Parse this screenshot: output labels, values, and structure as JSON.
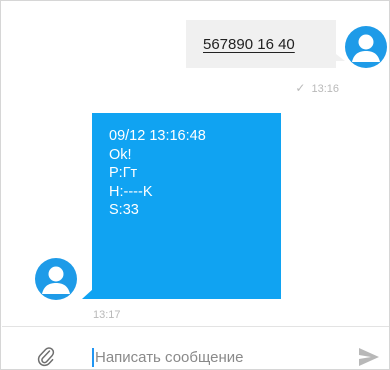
{
  "chat": {
    "outgoing": {
      "text": "567890 16 40",
      "status_icon": "check-icon",
      "status_glyph": "✓",
      "time": "13:16"
    },
    "incoming": {
      "lines": [
        "09/12 13:16:48",
        "Ok!",
        "P:Гт",
        "H:----K",
        "S:33"
      ],
      "time": "13:17"
    }
  },
  "composer": {
    "placeholder": "Написать сообщение",
    "attach_icon": "paperclip-icon",
    "send_icon": "send-icon"
  },
  "colors": {
    "incoming_bubble": "#10a3f2",
    "outgoing_bubble": "#f0f0f0",
    "avatar": "#1e9be8",
    "meta_text": "#b9b9b9"
  }
}
